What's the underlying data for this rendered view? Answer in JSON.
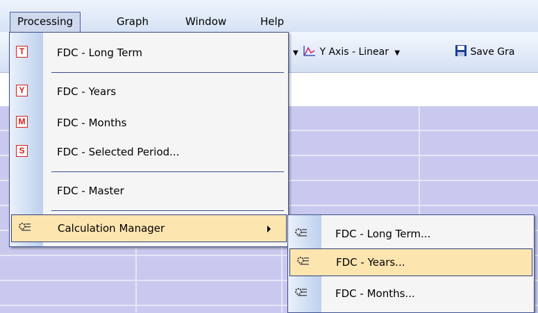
{
  "menubar": {
    "items": [
      "Processing",
      "Graph",
      "Window",
      "Help"
    ]
  },
  "toolbar": {
    "y_axis_label": "Y Axis - Linear",
    "save_label": "Save Gra"
  },
  "processing_menu": {
    "items": [
      {
        "icon_letter": "T",
        "label": "FDC - Long Term"
      },
      {
        "icon_letter": "Y",
        "label": "FDC - Years"
      },
      {
        "icon_letter": "M",
        "label": "FDC - Months"
      },
      {
        "icon_letter": "S",
        "label": "FDC - Selected Period..."
      },
      {
        "icon_letter": "",
        "label": "FDC - Master"
      },
      {
        "icon_letter": "",
        "label": "Calculation Manager"
      }
    ]
  },
  "calc_submenu": {
    "items": [
      {
        "label": "FDC - Long Term..."
      },
      {
        "label": "FDC - Years..."
      },
      {
        "label": "FDC - Months..."
      }
    ]
  },
  "colors": {
    "menu_border": "#3c4f8e",
    "highlight": "#fde5b0",
    "icon_red": "#d61d1d",
    "grid_bg": "#c9c9ef"
  }
}
